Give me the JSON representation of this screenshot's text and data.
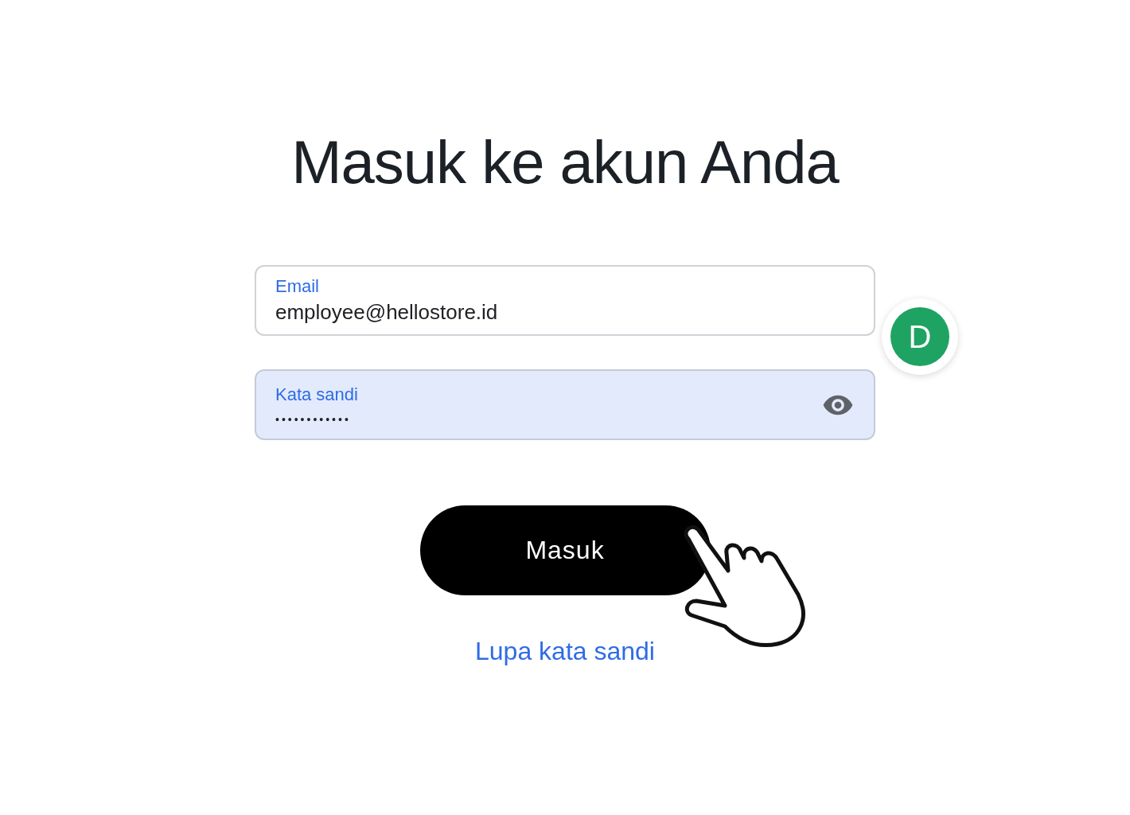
{
  "title": "Masuk ke akun Anda",
  "fields": [
    {
      "label": "Email",
      "value": "employee@hellostore.id",
      "autofilled": false,
      "kind": "text"
    },
    {
      "label": "Kata sandi",
      "value": "••••••••••••",
      "autofilled": true,
      "kind": "password"
    }
  ],
  "avatar": {
    "initial": "D",
    "color": "#1ea362"
  },
  "submit_button": "Masuk",
  "forgot_link": "Lupa kata sandi"
}
